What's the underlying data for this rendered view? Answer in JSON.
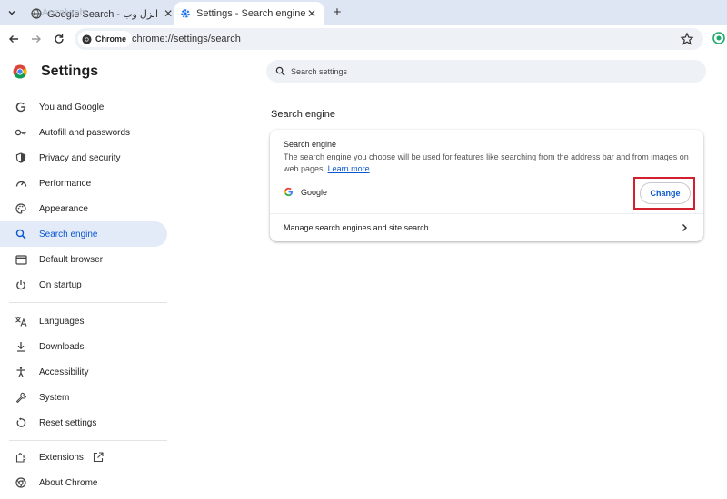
{
  "tabs": [
    {
      "title": "Google Search - انزل وب",
      "favicon": "globe-icon",
      "active": false
    },
    {
      "title": "Settings - Search engine",
      "favicon": "gear-icon",
      "active": true
    }
  ],
  "watermark": "Anzalweb",
  "toolbar": {
    "chip_label": "Chrome",
    "url": "chrome://settings/search"
  },
  "sidebar": {
    "title": "Settings",
    "items": [
      {
        "label": "You and Google",
        "icon": "google-g-icon"
      },
      {
        "label": "Autofill and passwords",
        "icon": "key-icon"
      },
      {
        "label": "Privacy and security",
        "icon": "shield-icon"
      },
      {
        "label": "Performance",
        "icon": "speedometer-icon"
      },
      {
        "label": "Appearance",
        "icon": "palette-icon"
      },
      {
        "label": "Search engine",
        "icon": "search-icon",
        "active": true
      },
      {
        "label": "Default browser",
        "icon": "browser-window-icon"
      },
      {
        "label": "On startup",
        "icon": "power-icon"
      },
      {
        "label": "Languages",
        "icon": "translate-icon"
      },
      {
        "label": "Downloads",
        "icon": "download-icon"
      },
      {
        "label": "Accessibility",
        "icon": "accessibility-icon"
      },
      {
        "label": "System",
        "icon": "wrench-icon"
      },
      {
        "label": "Reset settings",
        "icon": "reset-icon"
      },
      {
        "label": "Extensions",
        "icon": "puzzle-icon"
      },
      {
        "label": "About Chrome",
        "icon": "chrome-icon"
      }
    ]
  },
  "search": {
    "placeholder": "Search settings"
  },
  "main": {
    "section_title": "Search engine",
    "card": {
      "title": "Search engine",
      "description": "The search engine you choose will be used for features like searching from the address bar and from images on web pages.",
      "learn_more": "Learn more",
      "engine_name": "Google",
      "change_label": "Change",
      "manage_label": "Manage search engines and site search"
    }
  },
  "colors": {
    "accent": "#0b57d0",
    "active_bg": "#e3ebf8",
    "highlight": "#d3202f",
    "tabstrip": "#dfe6f3"
  }
}
